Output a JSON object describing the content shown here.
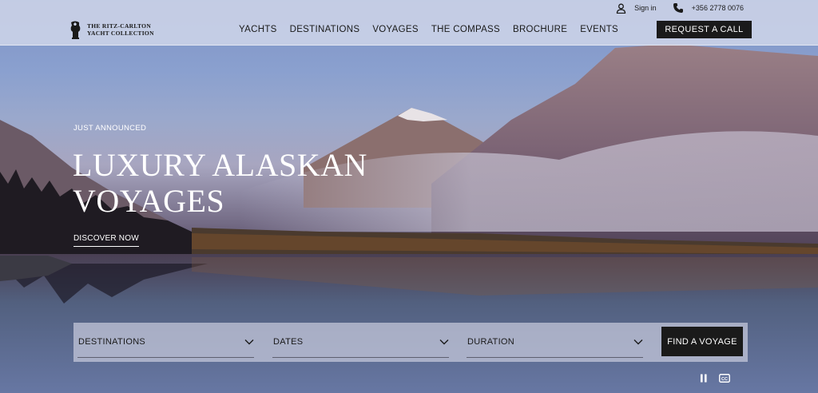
{
  "utility": {
    "sign_in": "Sign in",
    "phone": "+356 2778 0076"
  },
  "logo": {
    "line1": "THE RITZ-CARLTON",
    "line2": "YACHT COLLECTION"
  },
  "nav": {
    "items": [
      "YACHTS",
      "DESTINATIONS",
      "VOYAGES",
      "THE COMPASS",
      "BROCHURE",
      "EVENTS"
    ]
  },
  "cta": {
    "label": "REQUEST A CALL"
  },
  "hero": {
    "eyebrow": "JUST ANNOUNCED",
    "headline": "LUXURY ALASKAN VOYAGES",
    "link": "DISCOVER NOW"
  },
  "search": {
    "destinations": "DESTINATIONS",
    "dates": "DATES",
    "duration": "DURATION",
    "button": "FIND A VOYAGE"
  },
  "media_controls": {
    "pause": "pause-icon",
    "captions": "captions-icon"
  },
  "colors": {
    "dark": "#1a1a1a",
    "header_bg": "#cdd4e8",
    "text_light": "#ffffff"
  }
}
